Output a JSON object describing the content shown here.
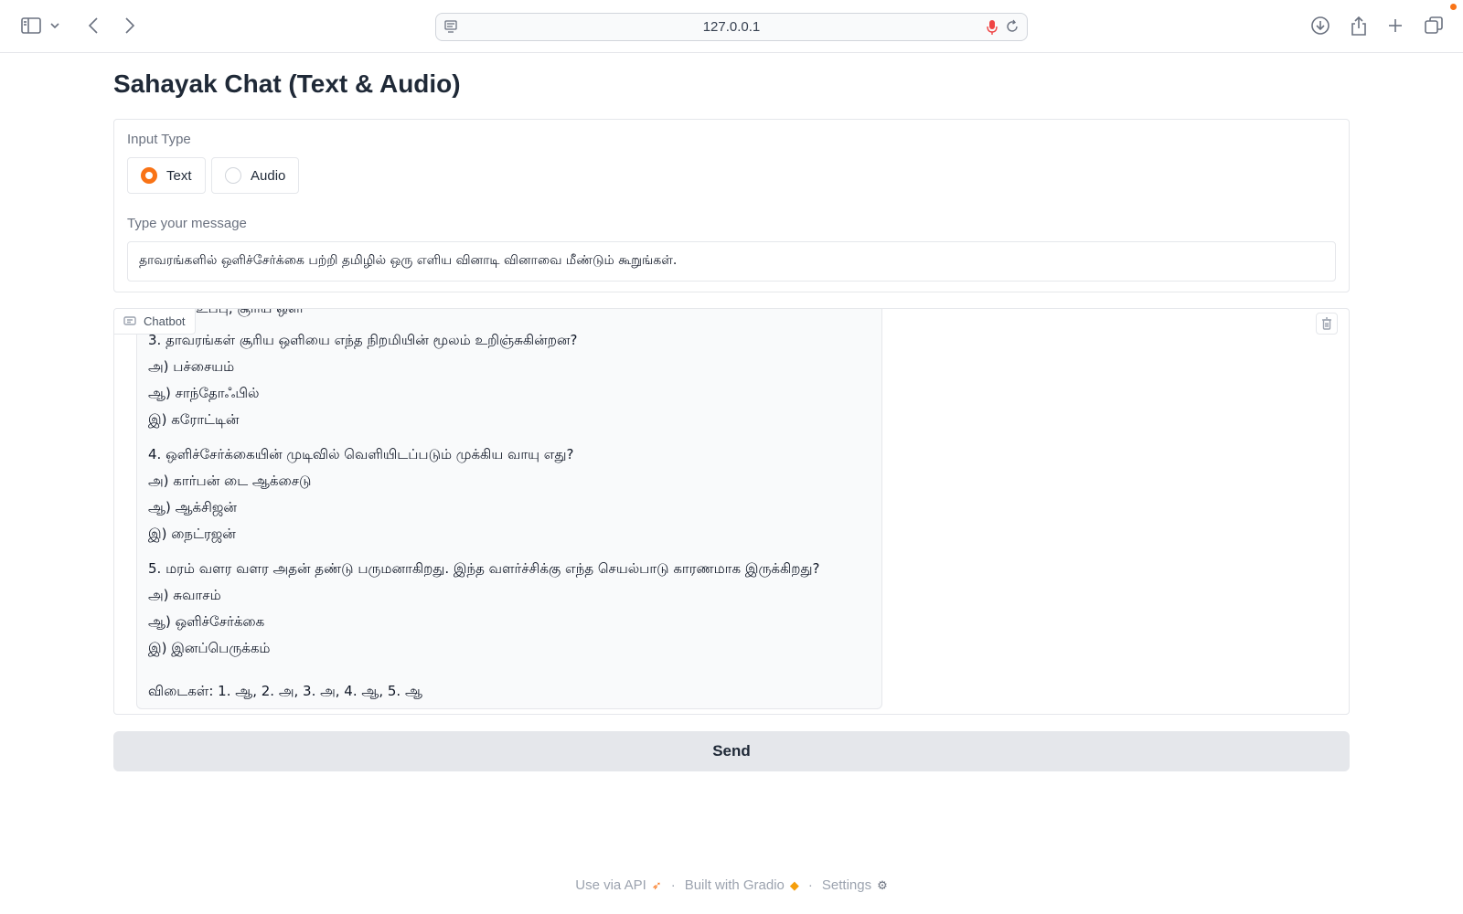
{
  "browser": {
    "url": "127.0.0.1"
  },
  "page": {
    "title": "Sahayak Chat (Text & Audio)"
  },
  "input_type": {
    "label": "Input Type",
    "options": [
      {
        "label": "Text",
        "selected": true
      },
      {
        "label": "Audio",
        "selected": false
      }
    ]
  },
  "message": {
    "label": "Type your message",
    "value": "தாவரங்களில் ஒளிச்சேர்க்கை பற்றி தமிழில் ஒரு எளிய வினாடி வினாவை மீண்டும் கூறுங்கள்."
  },
  "chatbot": {
    "label": "Chatbot",
    "partial_line": "உப்பு, சூரிய ஒளி",
    "lines": [
      "3. தாவரங்கள் சூரிய ஒளியை எந்த நிறமியின் மூலம் உறிஞ்சுகின்றன?",
      "அ) பச்சையம்",
      "ஆ) சாந்தோஃபில்",
      "இ) கரோட்டின்",
      "4. ஒளிச்சேர்க்கையின் முடிவில் வெளியிடப்படும் முக்கிய வாயு எது?",
      "அ) கார்பன் டை ஆக்சைடு",
      "ஆ) ஆக்சிஜன்",
      "இ) நைட்ரஜன்",
      "5. மரம் வளர வளர அதன் தண்டு பருமனாகிறது. இந்த வளர்ச்சிக்கு எந்த செயல்பாடு காரணமாக இருக்கிறது?",
      "அ) சுவாசம்",
      "ஆ) ஒளிச்சேர்க்கை",
      "இ) இனப்பெருக்கம்",
      "விடைகள்: 1. ஆ, 2. அ, 3. அ, 4. ஆ, 5. ஆ"
    ]
  },
  "send": {
    "label": "Send"
  },
  "footer": {
    "api": "Use via API",
    "built": "Built with Gradio",
    "settings": "Settings"
  },
  "colors": {
    "accent": "#f97316",
    "send_bg": "#e5e7eb"
  }
}
